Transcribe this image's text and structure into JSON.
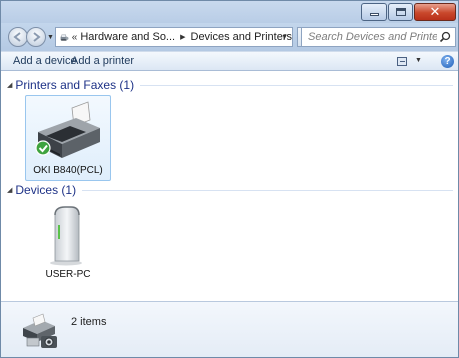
{
  "window": {
    "accent": "#b9cde6"
  },
  "address": {
    "overflow": "«",
    "crumbs": [
      "Hardware and So...",
      "Devices and Printers"
    ]
  },
  "search": {
    "placeholder": "Search Devices and Printers"
  },
  "toolbar": {
    "add_device": "Add a device",
    "add_printer": "Add a printer",
    "views_icon": "views-icon",
    "help_icon": "help-icon"
  },
  "groups": {
    "printers": {
      "title": "Printers and Faxes (1)",
      "items": [
        {
          "label": "OKI B840(PCL)",
          "icon": "printer-icon",
          "status": "default-printer-check",
          "selected": true
        }
      ]
    },
    "devices": {
      "title": "Devices (1)",
      "items": [
        {
          "label": "USER-PC",
          "icon": "computer-icon"
        }
      ]
    }
  },
  "details": {
    "count_text": "2 items",
    "icon": "devices-and-printers-icon"
  }
}
